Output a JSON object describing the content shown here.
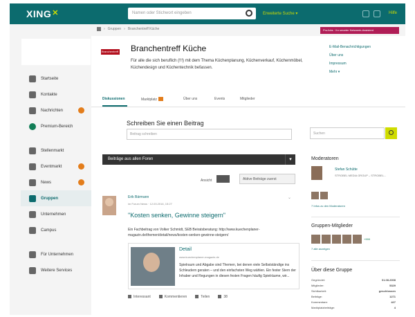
{
  "topbar": {
    "logo": "XING",
    "search_placeholder": "Namen oder Stichwort eingeben",
    "search_advanced": "Erweiterte Suche ▾",
    "account_label": "Hilfe"
  },
  "sidebar": {
    "items": [
      {
        "label": "Startseite",
        "icon": "home-icon",
        "badge": false
      },
      {
        "label": "Kontakte",
        "icon": "contacts-icon",
        "badge": false
      },
      {
        "label": "Nachrichten",
        "icon": "messages-icon",
        "badge": true
      },
      {
        "label": "Premium-Bereich",
        "icon": "premium-icon",
        "badge": false
      },
      {
        "label": "Stellenmarkt",
        "icon": "jobs-icon",
        "badge": false
      },
      {
        "label": "Eventmarkt",
        "icon": "events-icon",
        "badge": true
      },
      {
        "label": "News",
        "icon": "news-icon",
        "badge": true
      },
      {
        "label": "Gruppen",
        "icon": "groups-icon",
        "badge": false,
        "active": true
      },
      {
        "label": "Unternehmen",
        "icon": "companies-icon",
        "badge": false
      },
      {
        "label": "Campus",
        "icon": "campus-icon",
        "badge": false
      },
      {
        "label": "Für Unternehmen",
        "icon": "business-icon",
        "badge": false
      },
      {
        "label": "Weitere Services",
        "icon": "services-icon",
        "badge": false
      }
    ]
  },
  "breadcrumb": {
    "items": [
      "Gruppen",
      "Branchentreff Küche"
    ]
  },
  "premium_tag": "ProJobs · Ihr smarter Netzwerk-Assistent",
  "group": {
    "logo_text": "Branchentreff",
    "title": "Branchentreff Küche",
    "description": "Für alle die sich beruflich (!!!) mit dem Thema Küchenplanung, Küchenverkauf, Küchenmöbel, Küchendesign und Küchentechnik befassen.",
    "actions": [
      "E-Mail-Benachrichtigungen",
      "Über uns",
      "Impressum",
      "Mehr ▾"
    ]
  },
  "tabs": [
    {
      "label": "Diskussionen",
      "active": true
    },
    {
      "label": "Marktplatz",
      "active": false,
      "badge": true
    },
    {
      "label": "Über uns",
      "active": false
    },
    {
      "label": "Events",
      "active": false
    },
    {
      "label": "Mitglieder",
      "active": false
    }
  ],
  "composer": {
    "title": "Schreiben Sie einen Beitrag",
    "placeholder": "Beitrag schreiben"
  },
  "filter": {
    "placeholder": "Suchen"
  },
  "feed": {
    "bar_label": "Beiträge aus allen Foren",
    "view_label": "Ansicht",
    "sort_label": "Aktive Beiträge zuerst"
  },
  "post": {
    "author": "Erik Bärmann",
    "meta": "im Forum News · 12.03.2016, 15:27",
    "title": "\"Kosten senken, Gewinne steigern\"",
    "text": "Ein Fachbeitrag von Volker Schmidt, SEB Beiratsberatung: http://www.kuechenplaner-magazin.de/themen/detail/news/kosten-senken-gewinne-steigern/",
    "preview": {
      "title": "Detail",
      "url": "www.kuechenplaner-magazin.de",
      "desc": "Spielraum und Abgabe sind Themen, bei denen viele Selbstständige ins Schleudern geraten – und den einfachsten Weg wählen. Ein fester Stern der Inhaber und Regungen in diesen festen Fragen häufig Spielräume, wir..."
    },
    "actions": [
      {
        "label": "Interessant",
        "icon": "thumb-icon"
      },
      {
        "label": "Kommentieren",
        "icon": "comment-icon"
      },
      {
        "label": "Teilen",
        "icon": "share-icon"
      },
      {
        "label": "38",
        "icon": "eye-icon"
      }
    ]
  },
  "right": {
    "moderators_title": "Moderatoren",
    "moderator_name": "Stefan Schütte",
    "moderator_company": "STROBEL MEDIA GROUP – STROBEL...",
    "moderators_link": "7 Infos zu den Moderatoren",
    "members_title": "Gruppen-Mitglieder",
    "members_more": "+999",
    "members_link": "7 alle anzeigen",
    "about_title": "Über diese Gruppe",
    "stats": [
      {
        "label": "Gegründet:",
        "value": "01.08.2008"
      },
      {
        "label": "Mitglieder:",
        "value": "5329"
      },
      {
        "label": "Sichtbarkeit:",
        "value": "geschlossen"
      },
      {
        "label": "Beiträge:",
        "value": "1271"
      },
      {
        "label": "Kommentare:",
        "value": "427"
      },
      {
        "label": "Marktplatzbeiträge:",
        "value": "4"
      }
    ]
  }
}
